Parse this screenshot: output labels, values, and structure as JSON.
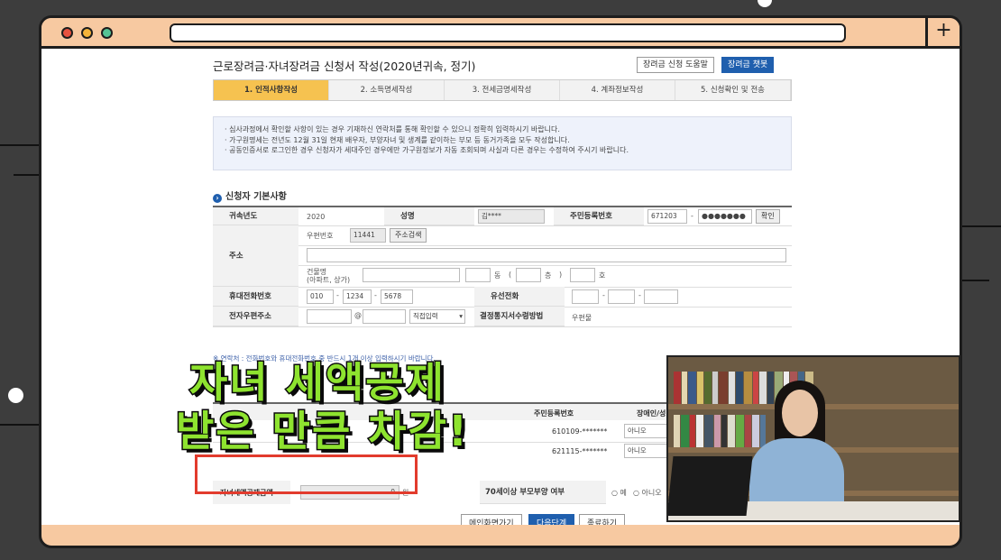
{
  "page": {
    "title": "근로장려금·자녀장려금 신청서 작성(2020년귀속, 정기)",
    "help_button": "장려금 신청 도움말",
    "chatbot_button": "장려금 챗봇"
  },
  "steps": [
    {
      "label": "1. 인적사항작성",
      "active": true
    },
    {
      "label": "2. 소득명세작성",
      "active": false
    },
    {
      "label": "3. 전세금명세작성",
      "active": false
    },
    {
      "label": "4. 계좌정보작성",
      "active": false
    },
    {
      "label": "5. 신청확인 및 전송",
      "active": false
    }
  ],
  "notice": [
    "· 심사과정에서 확인할 사항이 있는 경우 기재하신 연락처를 통해 확인할 수 있으니 정확히 입력하시기 바랍니다.",
    "· 가구원명세는 전년도 12월 31일 현재 배우자, 부양자녀 및 생계를 같이하는 부모 등 동거가족을 모두 작성합니다.",
    "· 공동인증서로 로그인한 경우 신청자가 세대주인 경우에만 가구원정보가 자동 조회되며 사실과 다른 경우는 수정하여 주시기 바랍니다."
  ],
  "section_title": "신청자 기본사항",
  "form": {
    "year_label": "귀속년도",
    "year_value": "2020",
    "name_label": "성명",
    "name_value": "김****",
    "rrn_label": "주민등록번호",
    "rrn_front": "671203",
    "rrn_dash": "-",
    "rrn_back": "●●●●●●●",
    "confirm_button": "확인",
    "address_label": "주소",
    "postal_label": "우편번호",
    "postal_value": "11441",
    "address_search_button": "주소검색",
    "building_label": "건물명",
    "building_sub": "(아파트, 상가)",
    "dong_label": "동",
    "paren_open": "(",
    "floor_label": "층",
    "paren_close": ")",
    "ho_label": "호",
    "mobile_label": "휴대전화번호",
    "mobile_1": "010",
    "mobile_2": "1234",
    "mobile_3": "5678",
    "phone_label": "유선전화",
    "email_label": "전자우편주소",
    "email_at": "@",
    "email_domain_select": "직접입력",
    "notify_label": "결정통지서수령방법",
    "notify_value": "우편물"
  },
  "footnote": "※ 연락처 : 전화번호와 휴대전화번호 중 반드시 1개 이상 입력하시기 바랍니다.",
  "family_table": {
    "header_rrn": "주민등록번호",
    "header_disabled": "장애인/성",
    "rows": [
      {
        "rrn": "610109-*******",
        "disabled": "아니오"
      },
      {
        "rrn": "621115-*******",
        "disabled": "아니오"
      }
    ]
  },
  "deduction": {
    "label": "자녀세액공제금액",
    "value": "0",
    "unit": "원",
    "parent_label": "70세이상 부모부양 여부",
    "opt_yes": "예",
    "opt_no": "아니오"
  },
  "buttons": {
    "main": "메인화면가기",
    "next": "다음단계",
    "close": "종료하기"
  },
  "caption": {
    "line1": "자녀 세액공제",
    "line2": "받은 만큼 차감!"
  },
  "colors": {
    "frame": "#f7c9a1",
    "caption": "#8ee32f",
    "accent": "#1f5fae",
    "step_active": "#f6c250",
    "highlight_box": "#e23b2d"
  }
}
